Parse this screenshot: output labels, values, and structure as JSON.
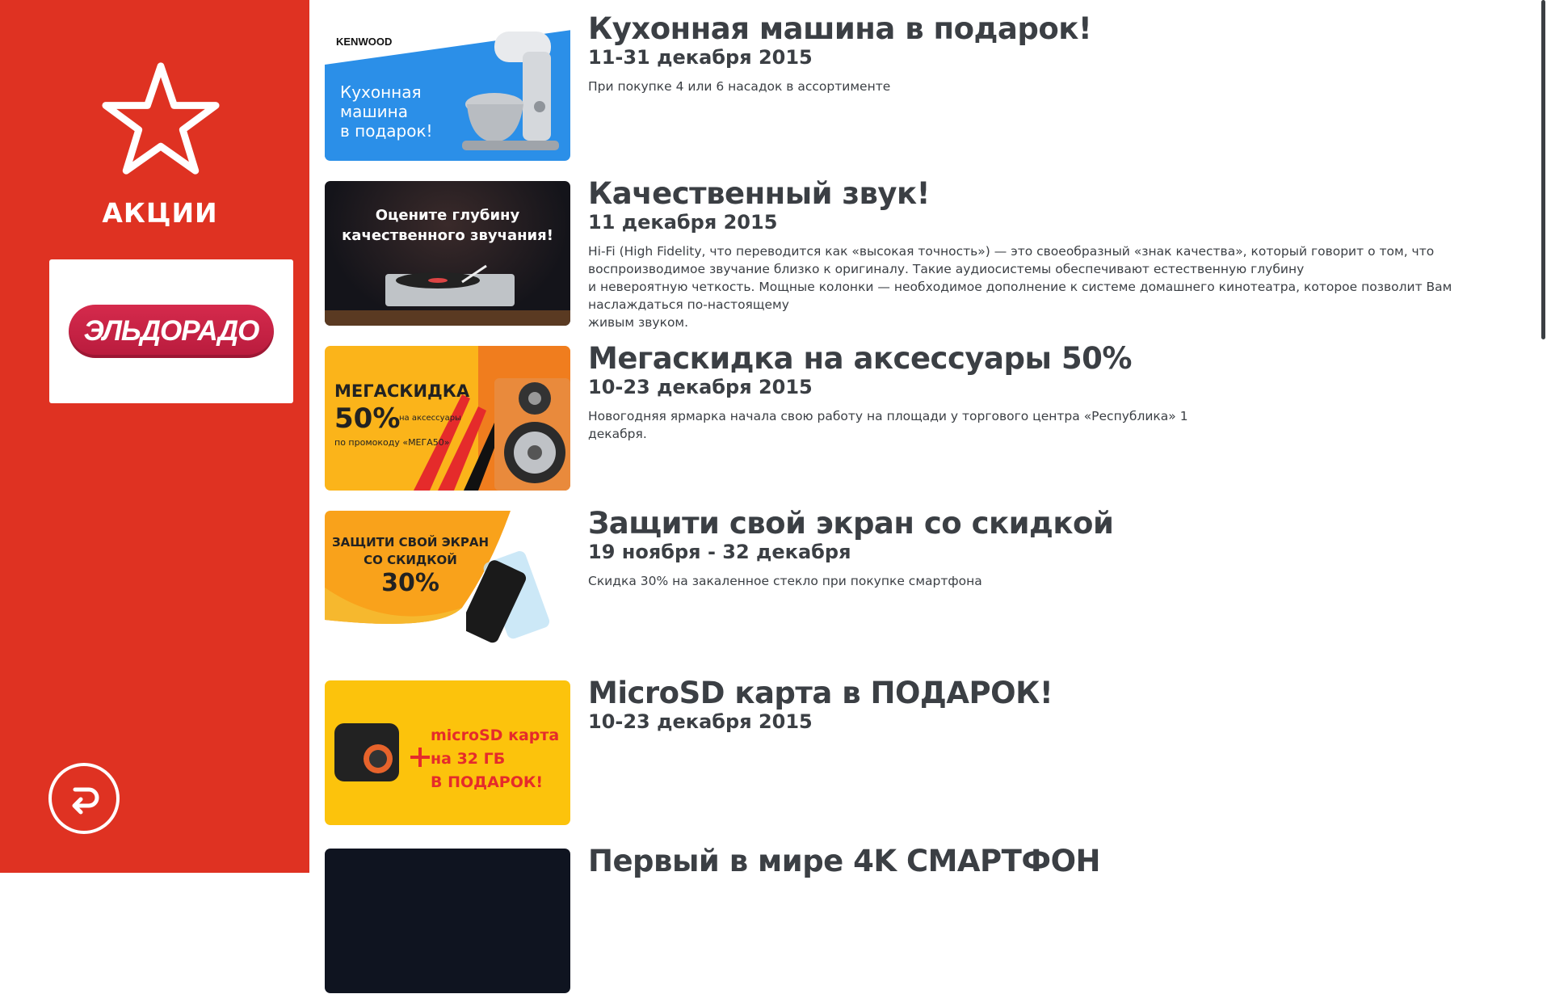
{
  "sidebar": {
    "title": "АКЦИИ",
    "logo_text": "ЭЛЬДОРАДО",
    "bg_color": "#df3222"
  },
  "icons": {
    "section": "star-icon",
    "back": "back-arrow-icon"
  },
  "promos": [
    {
      "title": "Кухонная машина в подарок!",
      "dates": "11-31 декабря 2015",
      "description": "При покупке 4 или 6 насадок в ассортименте",
      "banner": {
        "brand": "KENWOOD",
        "text": "Кухонная\nмашина\nв подарок!",
        "color": "#2b8fe8"
      }
    },
    {
      "title": "Качественный звук!",
      "dates": "11 декабря 2015",
      "description": "Hi-Fi (High Fidelity, что переводится как «высокая точность») — это своеобразный «знак качества», который говорит о том, что\nвоспроизводимое звучание близко к оригиналу. Такие аудиосистемы обеспечивают естественную глубину\nи невероятную четкость. Мощные колонки — необходимое дополнение к системе домашнего кинотеатра, которое позволит Вам\nнаслаждаться по-настоящему\nживым звуком.",
      "banner": {
        "text": "Оцените глубину\nкачественного звучания!",
        "color": "#1b1b22"
      }
    },
    {
      "title": "Мегаскидка на аксессуары 50%",
      "dates": "10-23 декабря 2015",
      "description": "Новогодняя ярмарка начала свою работу на площади у торгового центра «Республика» 1\nдекабря.",
      "banner": {
        "headline": "МЕГАСКИДКА",
        "percent": "50%",
        "small": "на аксессуары",
        "promo": "по промокоду «МЕГА50»",
        "color": "#fbb41a"
      }
    },
    {
      "title": "Защити свой экран со скидкой",
      "dates": "19 ноября - 32 декабря",
      "description": "Скидка 30% на закаленное стекло при покупке смартфона",
      "banner": {
        "text": "ЗАЩИТИ СВОЙ ЭКРАН\nСО СКИДКОЙ",
        "percent": "30%",
        "color": "#f9a21b"
      }
    },
    {
      "title": "MicroSD карта в ПОДАРОК!",
      "dates": "10-23 декабря 2015",
      "description": "",
      "banner": {
        "text": "microSD карта\nна 32 ГБ\nВ ПОДАРОК!",
        "color": "#fcc30c"
      }
    },
    {
      "title": "Первый в мире 4K СМАРТФОН",
      "dates": "",
      "description": "",
      "banner": {
        "color": "#0f1420"
      }
    }
  ]
}
